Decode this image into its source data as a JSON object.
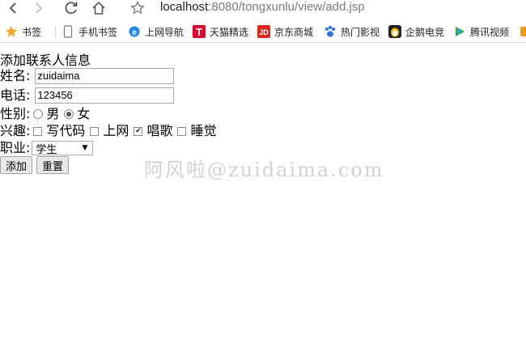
{
  "browser": {
    "url_host": "localhost",
    "url_rest": ":8080/tongxunlu/view/add.jsp",
    "bookmarks": [
      {
        "label": "书签",
        "icon": "star-icon"
      },
      {
        "label": "手机书签",
        "icon": "mobile-icon"
      },
      {
        "label": "上网导航",
        "icon": "ie-icon"
      },
      {
        "label": "天猫精选",
        "icon": "tmall-icon"
      },
      {
        "label": "京东商城",
        "icon": "jd-icon"
      },
      {
        "label": "热门影视",
        "icon": "paw-icon"
      },
      {
        "label": "企鹅电竞",
        "icon": "penguin-icon"
      },
      {
        "label": "腾讯视频",
        "icon": "tencent-video-icon"
      }
    ]
  },
  "form": {
    "heading": "添加联系人信息",
    "name_label": "姓名:",
    "name_value": "zuidaima",
    "phone_label": "电话:",
    "phone_value": "123456",
    "gender_label": "性别:",
    "gender_options": [
      {
        "label": "男",
        "checked": false
      },
      {
        "label": "女",
        "checked": true
      }
    ],
    "hobby_label": "兴趣:",
    "hobby_options": [
      {
        "label": "写代码",
        "checked": false
      },
      {
        "label": "上网",
        "checked": false
      },
      {
        "label": "唱歌",
        "checked": true
      },
      {
        "label": "睡觉",
        "checked": false
      }
    ],
    "job_label": "职业:",
    "job_selected": "学生",
    "submit_label": "添加",
    "reset_label": "重置"
  },
  "watermark": "阿风啦@zuidaima.com",
  "colors": {
    "star": "#f5a623",
    "tmall": "#e4002b",
    "jd": "#e1251b",
    "ie": "#1e88e5",
    "paw": "#2f6fe0",
    "tencent_video": "#20a84b"
  }
}
